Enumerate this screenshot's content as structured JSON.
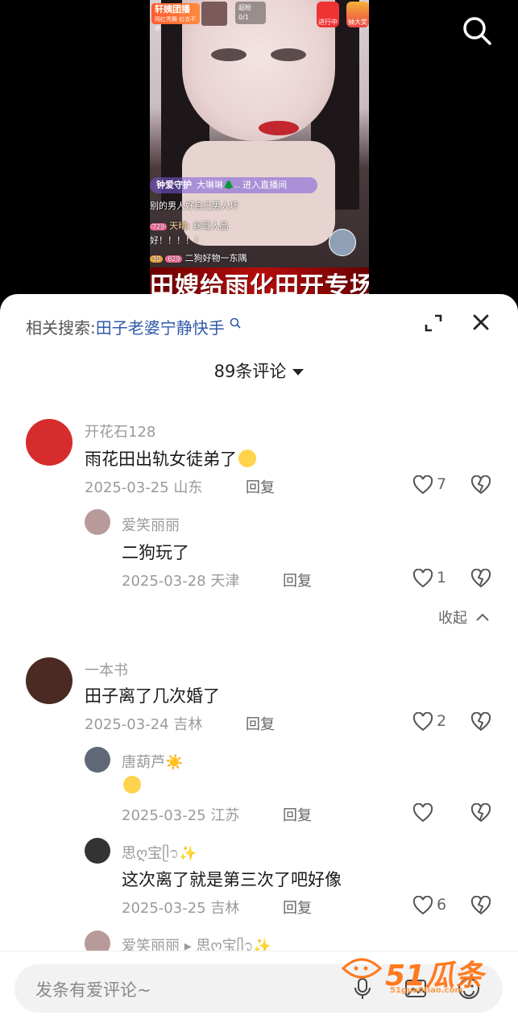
{
  "live": {
    "team_label": "轩姨团播",
    "team_sub": "网红秀舞 红衣不停",
    "fans_label": "超粉",
    "fans_value": "0/1",
    "activity_1": "进行中",
    "activity_2": "抽大奖",
    "guard_label": "钟爱守护",
    "guard_text": "大琳琳🌲.. 进入直播间",
    "chat": [
      {
        "text": "别的男人好自己男人坏"
      },
      {
        "level": "729",
        "name": "天晴:",
        "text": "丝哥人品"
      },
      {
        "text": "好！！！！！"
      },
      {
        "level": "30",
        "level2": "629",
        "text": "二狗好物一东隅"
      }
    ],
    "banner": "田嫂给雨化田开专场"
  },
  "sheet": {
    "related_label": "相关搜索:",
    "related_keyword": "田子老婆宁静快手",
    "comment_count": "89条评论"
  },
  "comments": [
    {
      "name": "开花石128",
      "text": "雨花田出轨女徒弟了",
      "date": "2025-03-25 山东",
      "reply": "回复",
      "likes": "7",
      "avatar_color": "#d62c2c"
    },
    {
      "name": "爱笑丽丽",
      "text": "二狗玩了",
      "date": "2025-03-28 天津",
      "reply": "回复",
      "likes": "1",
      "avatar_color": "#b99a9a"
    },
    {
      "name": "一本书",
      "text": "田子离了几次婚了",
      "date": "2025-03-24 吉林",
      "reply": "回复",
      "likes": "2",
      "avatar_color": "#4a2a22"
    },
    {
      "name": "唐葫芦☀️",
      "text": "",
      "date": "2025-03-25 江苏",
      "reply": "回复",
      "likes": "",
      "avatar_color": "#606878"
    },
    {
      "name": "思ღ宝ᥫ᭡✨",
      "text": "这次离了就是第三次了吧好像",
      "date": "2025-03-25 吉林",
      "reply": "回复",
      "likes": "6",
      "avatar_color": "#333333"
    },
    {
      "name": "爱笑丽丽 ▸ 思ღ宝ᥫ᭡✨",
      "avatar_color": "#b99a9a"
    }
  ],
  "collapse_label": "收起",
  "input_placeholder": "发条有爱评论~",
  "watermark": {
    "big": "51瓜条",
    "small": "51gua0tiao.com"
  },
  "icons": [
    "search-icon",
    "expand-icon",
    "close-icon",
    "heart-icon",
    "broken-heart-icon",
    "microphone-icon",
    "image-icon",
    "emoji-icon",
    "chevron-up-icon",
    "caret-down-icon"
  ]
}
